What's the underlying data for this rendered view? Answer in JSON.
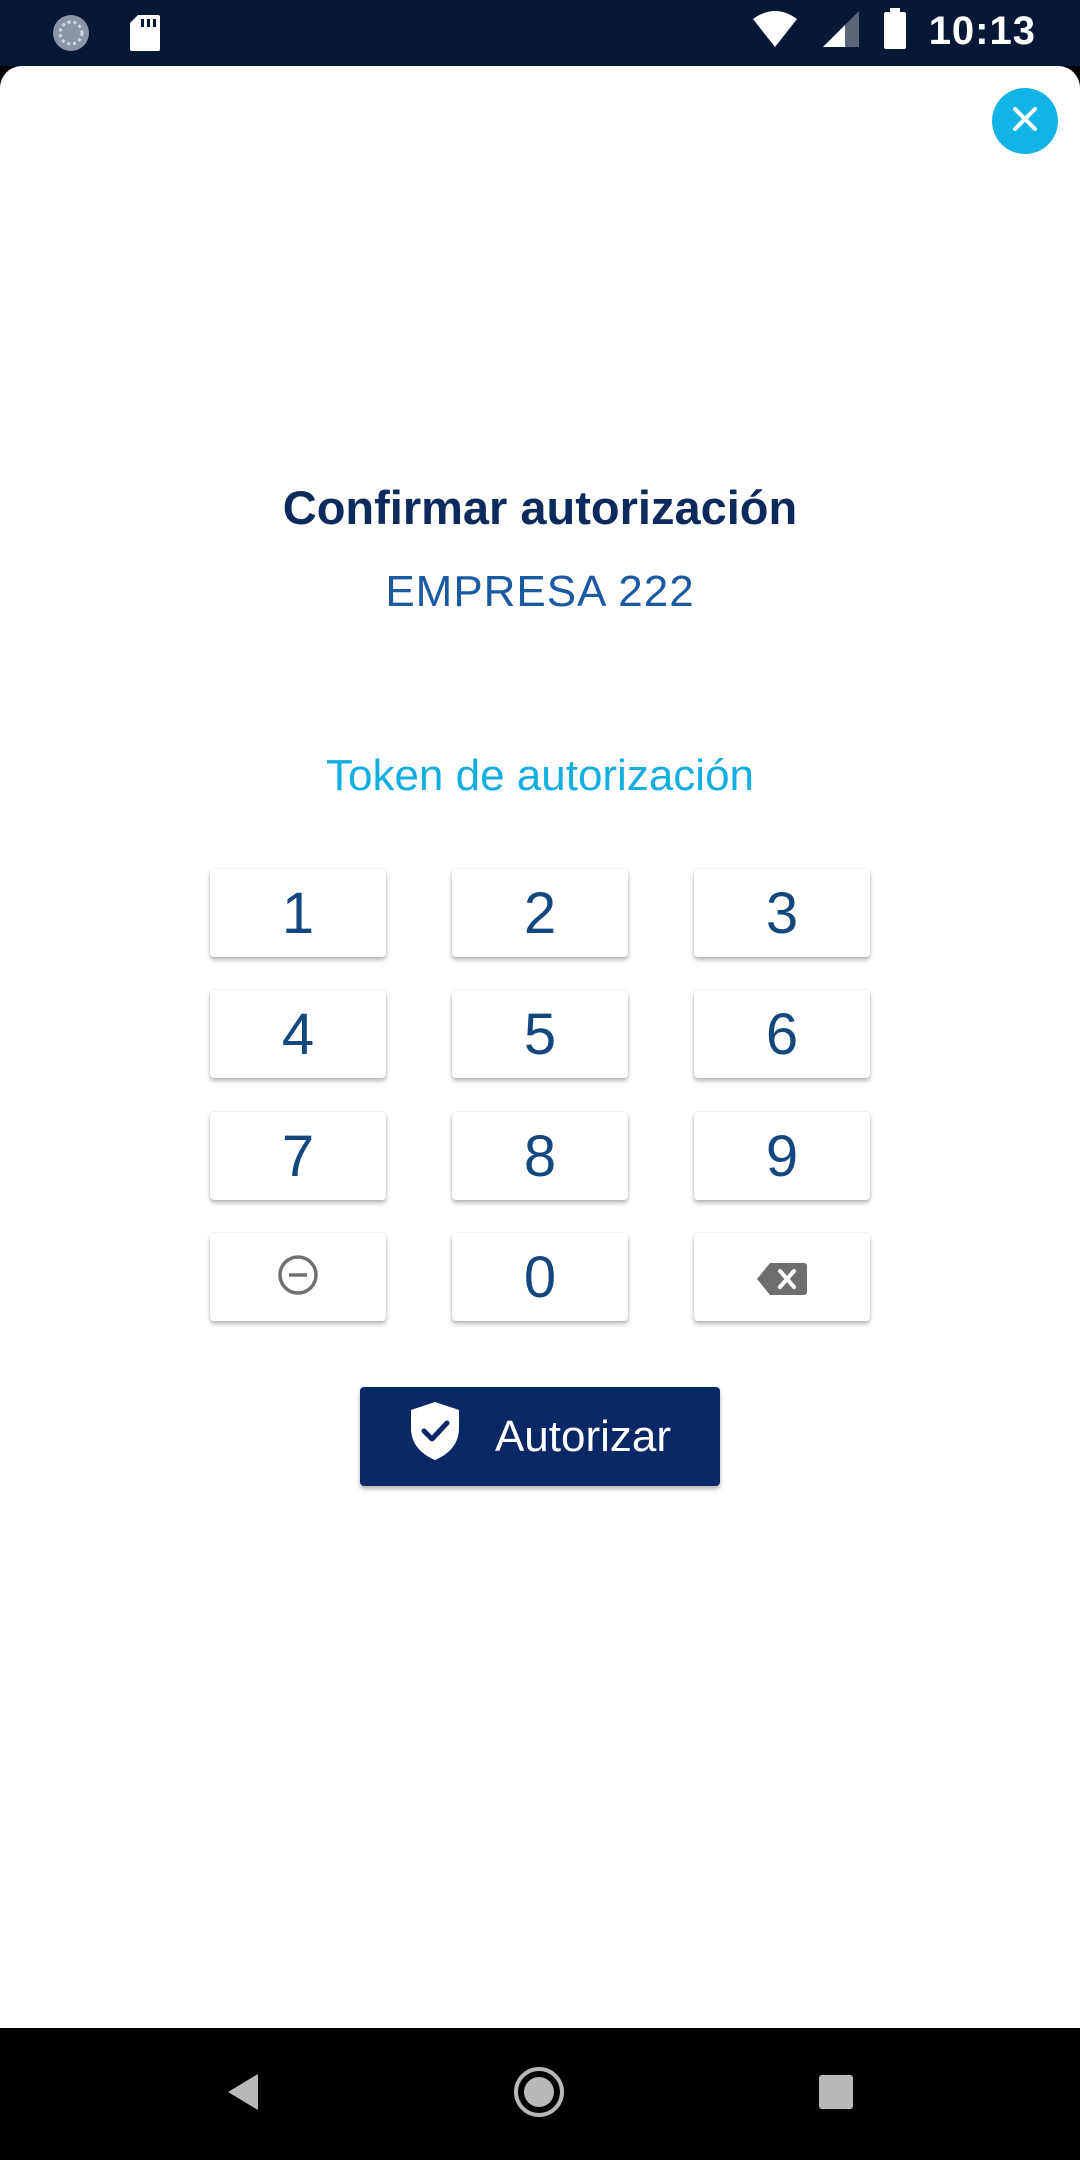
{
  "status_bar": {
    "time": "10:13",
    "icons": [
      "sync-icon",
      "sd-card-icon",
      "wifi-icon",
      "signal-icon",
      "battery-icon"
    ]
  },
  "dialog": {
    "title": "Confirmar autorización",
    "company": "EMPRESA 222",
    "token_label": "Token de autorización",
    "close_icon": "close-icon"
  },
  "keypad": {
    "keys": [
      "1",
      "2",
      "3",
      "4",
      "5",
      "6",
      "7",
      "8",
      "9",
      "",
      "0",
      ""
    ],
    "minus_icon": "minus-circle-icon",
    "backspace_icon": "backspace-icon"
  },
  "authorize_button": {
    "label": "Autorizar",
    "icon": "shield-check-icon"
  },
  "nav_bar": {
    "icons": [
      "back-icon",
      "home-icon",
      "recents-icon"
    ]
  },
  "colors": {
    "status_bar": "#051838",
    "title": "#0c2a5c",
    "accent": "#12b4e6",
    "key_text": "#13487f",
    "button": "#0a2866"
  }
}
